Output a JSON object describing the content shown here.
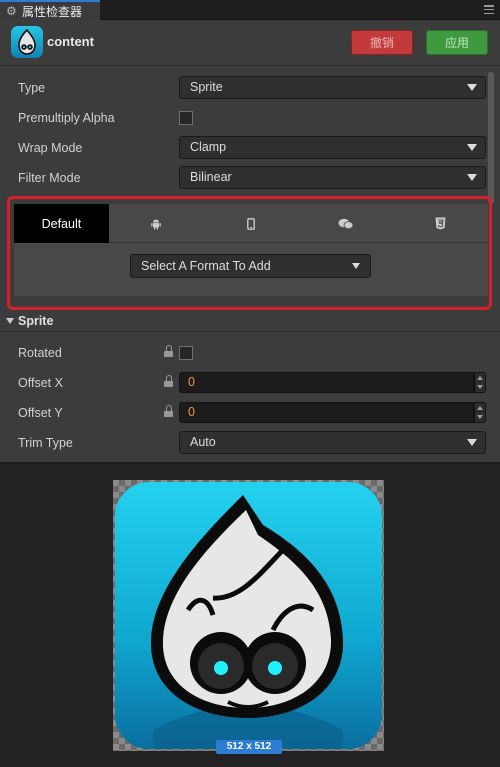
{
  "tab": {
    "title": "属性检查器",
    "icon": "gear-icon"
  },
  "node": {
    "name": "content",
    "icon": "cocos-logo-icon"
  },
  "buttons": {
    "revert": "撤销",
    "apply": "应用"
  },
  "properties": {
    "type": {
      "label": "Type",
      "value": "Sprite"
    },
    "premultiply": {
      "label": "Premultiply Alpha",
      "checked": false
    },
    "wrap": {
      "label": "Wrap Mode",
      "value": "Clamp"
    },
    "filter": {
      "label": "Filter Mode",
      "value": "Bilinear"
    }
  },
  "platforms": {
    "tabs": [
      {
        "label": "Default",
        "icon": "default",
        "active": true
      },
      {
        "label": "",
        "icon": "android-icon"
      },
      {
        "label": "",
        "icon": "mobile-phone-icon"
      },
      {
        "label": "",
        "icon": "wechat-icon"
      },
      {
        "label": "",
        "icon": "html5-icon"
      }
    ],
    "add_format": "Select A Format To Add"
  },
  "sprite": {
    "title": "Sprite",
    "rotated": {
      "label": "Rotated",
      "checked": false
    },
    "offset_x": {
      "label": "Offset X",
      "value": "0"
    },
    "offset_y": {
      "label": "Offset Y",
      "value": "0"
    },
    "trim": {
      "label": "Trim Type",
      "value": "Auto"
    }
  },
  "preview": {
    "size": "512 x 512"
  },
  "colors": {
    "accent": "#2d7dd2",
    "revert": "#c23a3a",
    "apply": "#3f9a3f",
    "highlight": "#d71f2b",
    "number": "#f29a2e"
  }
}
